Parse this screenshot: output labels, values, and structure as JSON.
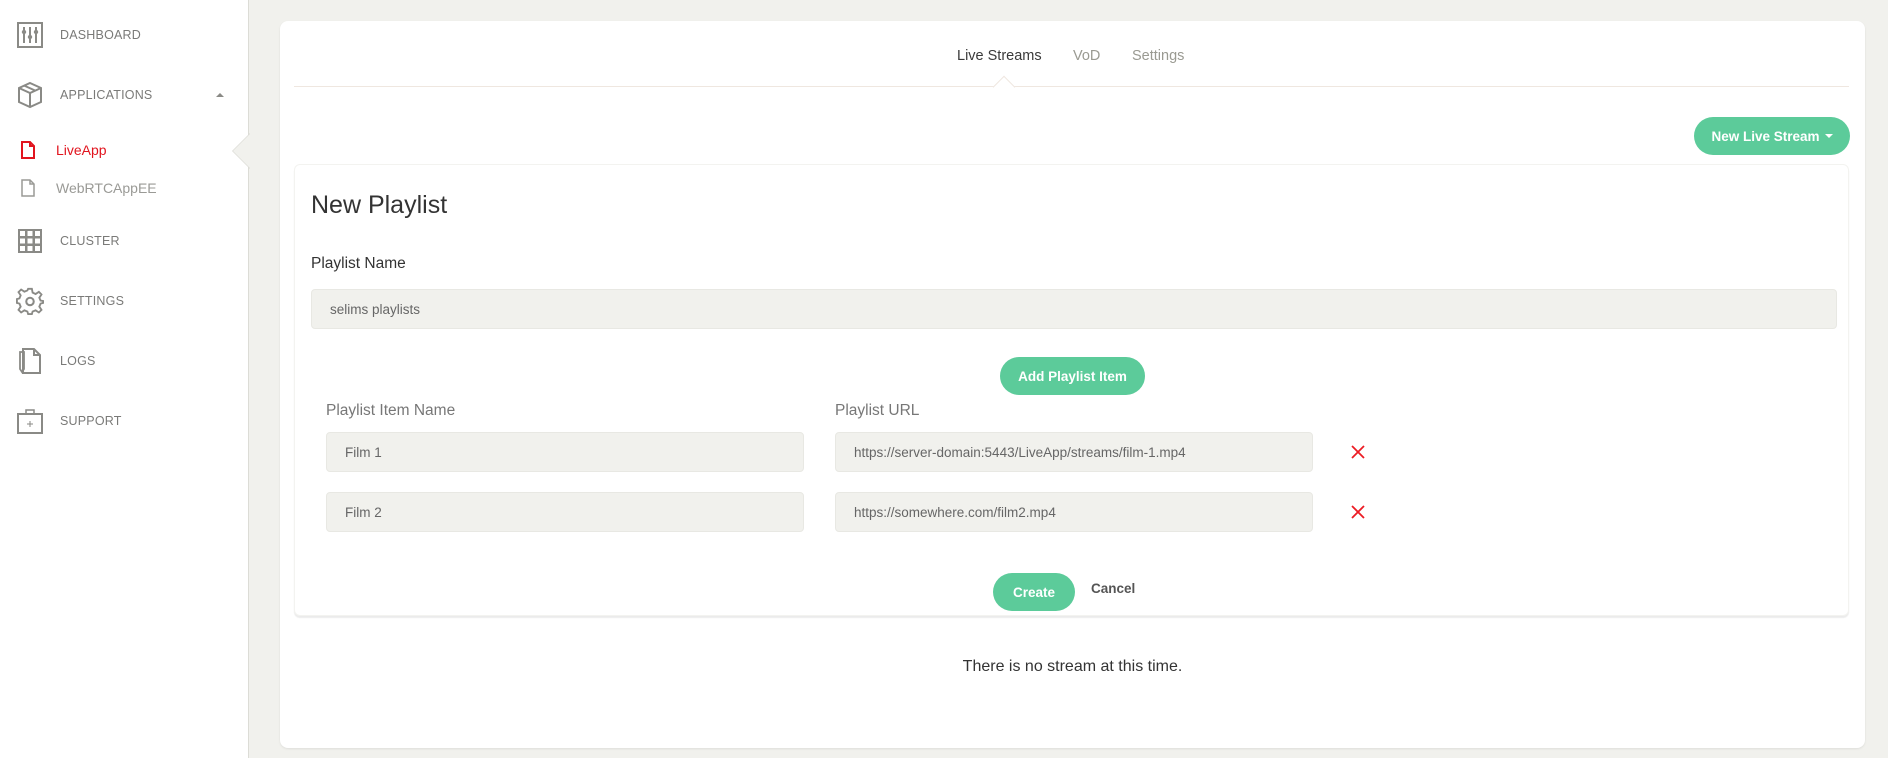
{
  "sidebar": {
    "items": [
      {
        "label": "DASHBOARD",
        "icon": "sliders-icon"
      },
      {
        "label": "APPLICATIONS",
        "icon": "box-icon",
        "expanded": true
      },
      {
        "label": "CLUSTER",
        "icon": "grid-icon"
      },
      {
        "label": "SETTINGS",
        "icon": "gear-icon"
      },
      {
        "label": "LOGS",
        "icon": "document-pen-icon"
      },
      {
        "label": "SUPPORT",
        "icon": "medical-kit-icon"
      }
    ],
    "applications": [
      {
        "label": "LiveApp",
        "active": true
      },
      {
        "label": "WebRTCAppEE",
        "active": false
      }
    ]
  },
  "tabs": [
    {
      "label": "Live Streams",
      "active": true
    },
    {
      "label": "VoD",
      "active": false
    },
    {
      "label": "Settings",
      "active": false
    }
  ],
  "new_stream_button": "New Live Stream",
  "playlist_form": {
    "title": "New Playlist",
    "name_label": "Playlist Name",
    "name_value": "selims playlists",
    "add_item_button": "Add Playlist Item",
    "item_name_header": "Playlist Item Name",
    "item_url_header": "Playlist URL",
    "items": [
      {
        "name": "Film 1",
        "url": "https://server-domain:5443/LiveApp/streams/film-1.mp4"
      },
      {
        "name": "Film 2",
        "url": "https://somewhere.com/film2.mp4"
      }
    ],
    "create_button": "Create",
    "cancel_button": "Cancel"
  },
  "empty_message": "There is no stream at this time.",
  "colors": {
    "accent_green": "#5ccb9a",
    "active_red": "#e1141e",
    "background": "#f1f1ed"
  }
}
